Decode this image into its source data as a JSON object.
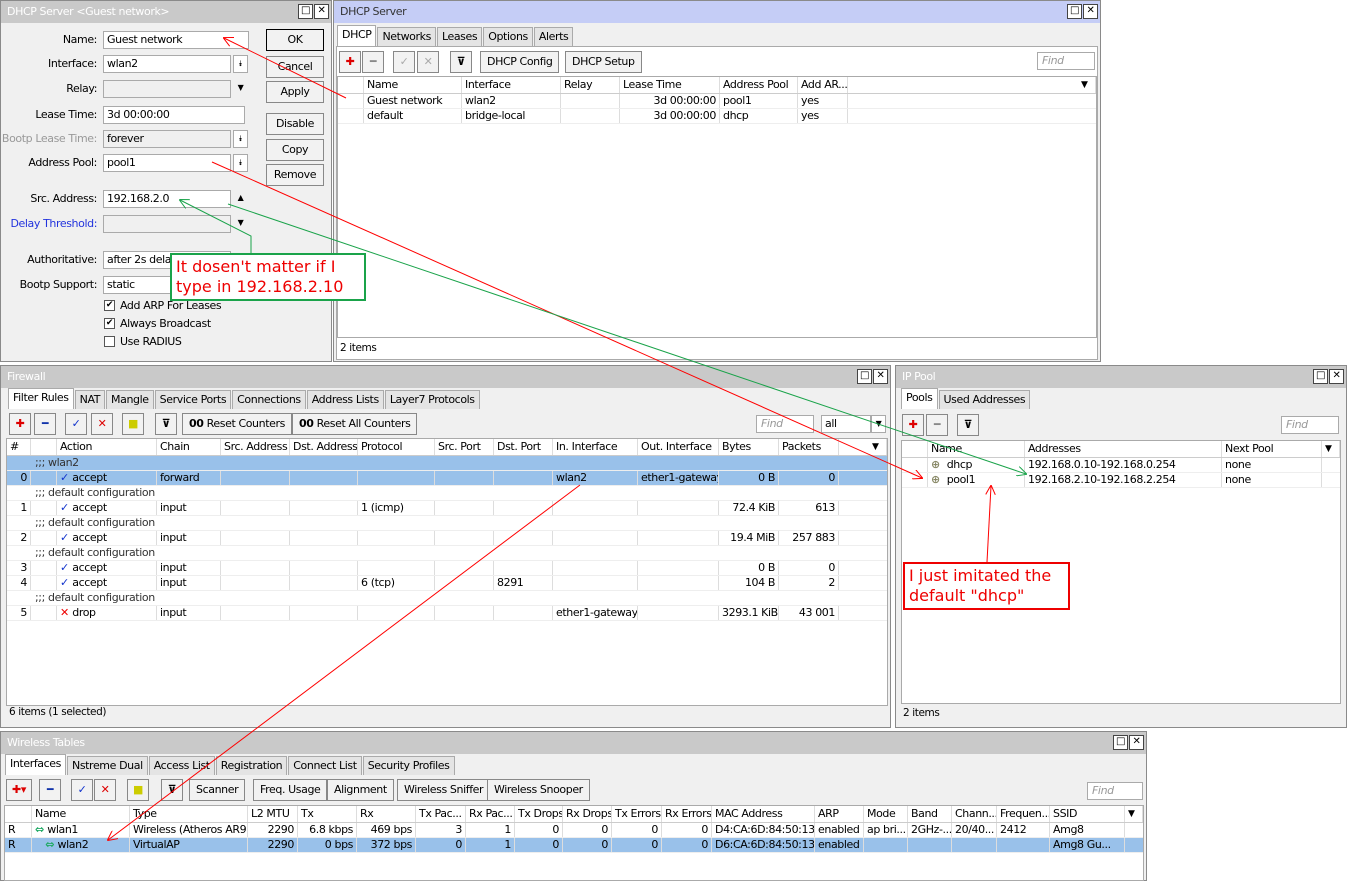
{
  "dhcp_form": {
    "title": "DHCP Server <Guest network>",
    "fields": [
      {
        "label": "Name:",
        "value": "Guest network"
      },
      {
        "label": "Interface:",
        "value": "wlan2"
      },
      {
        "label": "Relay:",
        "value": ""
      },
      {
        "label": "Lease Time:",
        "value": "3d 00:00:00"
      },
      {
        "label": "Bootp Lease Time:",
        "value": "forever"
      },
      {
        "label": "Address Pool:",
        "value": "pool1"
      },
      {
        "label": "Src. Address:",
        "value": "192.168.2.0"
      },
      {
        "label": "Delay Threshold:",
        "value": ""
      },
      {
        "label": "Authoritative:",
        "value": "after 2s delay"
      },
      {
        "label": "Bootp Support:",
        "value": "static"
      }
    ],
    "checkboxes": [
      {
        "label": "Add ARP For Leases",
        "checked": true
      },
      {
        "label": "Always Broadcast",
        "checked": true
      },
      {
        "label": "Use RADIUS",
        "checked": false
      }
    ],
    "buttons": [
      "OK",
      "Cancel",
      "Apply",
      "Disable",
      "Copy",
      "Remove"
    ]
  },
  "dhcp_server": {
    "title": "DHCP Server",
    "tabs": [
      "DHCP",
      "Networks",
      "Leases",
      "Options",
      "Alerts"
    ],
    "buttons": [
      "DHCP Config",
      "DHCP Setup"
    ],
    "find_placeholder": "Find",
    "columns": [
      "",
      "Name",
      "Interface",
      "Relay",
      "Lease Time",
      "Address Pool",
      "Add AR..."
    ],
    "rows": [
      {
        "cells": [
          "",
          "Guest network",
          "wlan2",
          "",
          "3d 00:00:00",
          "pool1",
          "yes"
        ]
      },
      {
        "cells": [
          "",
          "default",
          "bridge-local",
          "",
          "3d 00:00:00",
          "dhcp",
          "yes"
        ]
      }
    ],
    "status": "2 items"
  },
  "firewall": {
    "title": "Firewall",
    "tabs": [
      "Filter Rules",
      "NAT",
      "Mangle",
      "Service Ports",
      "Connections",
      "Address Lists",
      "Layer7 Protocols"
    ],
    "buttons": [
      "Reset Counters",
      "Reset All Counters"
    ],
    "find_placeholder": "Find",
    "filter_value": "all",
    "columns": [
      "#",
      "",
      "Action",
      "Chain",
      "Src. Address",
      "Dst. Address",
      "Protocol",
      "Src. Port",
      "Dst. Port",
      "In. Interface",
      "Out. Interface",
      "Bytes",
      "Packets"
    ],
    "rows": [
      {
        "comment": ";;; wlan2",
        "selected": true
      },
      {
        "cells": [
          "0",
          "",
          "accept",
          "forward",
          "",
          "",
          "",
          "",
          "",
          "wlan2",
          "ether1-gateway",
          "0 B",
          "0"
        ],
        "selected": true,
        "icon": "accept"
      },
      {
        "comment": ";;; default configuration"
      },
      {
        "cells": [
          "1",
          "",
          "accept",
          "input",
          "",
          "",
          "1 (icmp)",
          "",
          "",
          "",
          "",
          "72.4 KiB",
          "613"
        ],
        "icon": "accept"
      },
      {
        "comment": ";;; default configuration"
      },
      {
        "cells": [
          "2",
          "",
          "accept",
          "input",
          "",
          "",
          "",
          "",
          "",
          "",
          "",
          "19.4 MiB",
          "257 883"
        ],
        "icon": "accept"
      },
      {
        "comment": ";;; default configuration"
      },
      {
        "cells": [
          "3",
          "",
          "accept",
          "input",
          "",
          "",
          "",
          "",
          "",
          "",
          "",
          "0 B",
          "0"
        ],
        "icon": "accept"
      },
      {
        "cells": [
          "4",
          "",
          "accept",
          "input",
          "",
          "",
          "6 (tcp)",
          "",
          "8291",
          "",
          "",
          "104 B",
          "2"
        ],
        "icon": "accept"
      },
      {
        "comment": ";;; default configuration"
      },
      {
        "cells": [
          "5",
          "",
          "drop",
          "input",
          "",
          "",
          "",
          "",
          "",
          "ether1-gateway",
          "",
          "3293.1 KiB",
          "43 001"
        ],
        "icon": "drop"
      }
    ],
    "status": "6 items (1 selected)"
  },
  "ip_pool": {
    "title": "IP Pool",
    "tabs": [
      "Pools",
      "Used Addresses"
    ],
    "find_placeholder": "Find",
    "columns": [
      "",
      "Name",
      "Addresses",
      "Next Pool"
    ],
    "rows": [
      {
        "cells": [
          "",
          "dhcp",
          "192.168.0.10-192.168.0.254",
          "none"
        ]
      },
      {
        "cells": [
          "",
          "pool1",
          "192.168.2.10-192.168.2.254",
          "none"
        ]
      }
    ],
    "status": "2 items"
  },
  "wireless": {
    "title": "Wireless Tables",
    "tabs": [
      "Interfaces",
      "Nstreme Dual",
      "Access List",
      "Registration",
      "Connect List",
      "Security Profiles"
    ],
    "buttons": [
      "Scanner",
      "Freq. Usage",
      "Alignment",
      "Wireless Sniffer",
      "Wireless Snooper"
    ],
    "find_placeholder": "Find",
    "columns": [
      "",
      "Name",
      "Type",
      "L2 MTU",
      "Tx",
      "Rx",
      "Tx Pac...",
      "Rx Pac...",
      "Tx Drops",
      "Rx Drops",
      "Tx Errors",
      "Rx Errors",
      "MAC Address",
      "ARP",
      "Mode",
      "Band",
      "Chann...",
      "Frequen...",
      "SSID"
    ],
    "rows": [
      {
        "cells": [
          "R",
          "wlan1",
          "Wireless (Atheros AR9...",
          "2290",
          "6.8 kbps",
          "469 bps",
          "3",
          "1",
          "0",
          "0",
          "0",
          "0",
          "D4:CA:6D:84:50:13",
          "enabled",
          "ap bri...",
          "2GHz-...",
          "20/40...",
          "2412",
          "Amg8"
        ]
      },
      {
        "cells": [
          "R",
          "wlan2",
          "VirtualAP",
          "2290",
          "0 bps",
          "372 bps",
          "0",
          "1",
          "0",
          "0",
          "0",
          "0",
          "D6:CA:6D:84:50:13",
          "enabled",
          "",
          "",
          "",
          "",
          "Amg8 Gu..."
        ],
        "selected": true
      }
    ]
  },
  "annotations": {
    "src_note_line1": "It dosen't matter if I",
    "src_note_line2": "type in 192.168.2.10",
    "pool_note_line1": "I just imitated the",
    "pool_note_line2": "default \"dhcp\""
  },
  "colors": {
    "arrow_red": "#ff0000",
    "arrow_green": "#1aa34a",
    "selection": "#99c1ea"
  }
}
